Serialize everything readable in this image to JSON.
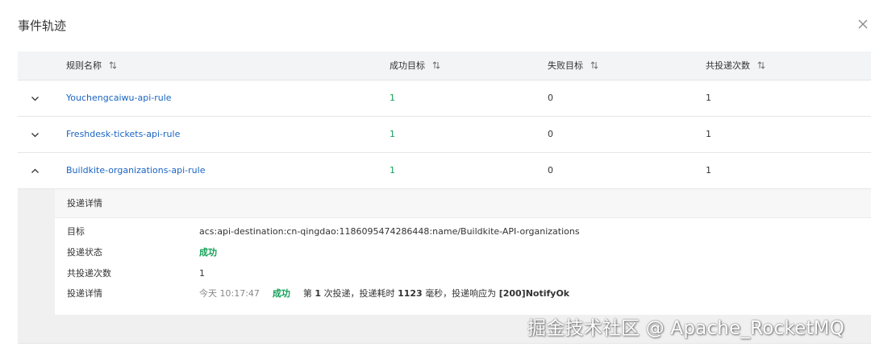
{
  "dialog": {
    "title": "事件轨迹",
    "close_icon": "close-icon"
  },
  "table": {
    "columns": [
      "规则名称",
      "成功目标",
      "失败目标",
      "共投递次数"
    ],
    "rows": [
      {
        "rule": "Youchengcaiwu-api-rule",
        "success": "1",
        "fail": "0",
        "total": "1",
        "expanded": false
      },
      {
        "rule": "Freshdesk-tickets-api-rule",
        "success": "1",
        "fail": "0",
        "total": "1",
        "expanded": false
      },
      {
        "rule": "Buildkite-organizations-api-rule",
        "success": "1",
        "fail": "0",
        "total": "1",
        "expanded": true
      }
    ]
  },
  "detail": {
    "title": "投递详情",
    "target_label": "目标",
    "target_value": "acs:api-destination:cn-qingdao:1186095474286448:name/Buildkite-API-organizations",
    "status_label": "投递状态",
    "status_value": "成功",
    "count_label": "共投递次数",
    "count_value": "1",
    "log_label": "投递详情",
    "log": {
      "time": "今天 10:17:47",
      "status": "成功",
      "t1": "第",
      "n1": "1",
      "t2": "次投递，投递耗时",
      "n2": "1123",
      "t3": "毫秒，投递响应为",
      "n3": "[200]NotifyOk"
    }
  },
  "watermark": "掘金技术社区 @ Apache_RocketMQ",
  "colors": {
    "link": "#1a64c2",
    "success": "#12a057",
    "header_bg": "#f3f4f6",
    "expand_bg": "#f0f0f0"
  }
}
